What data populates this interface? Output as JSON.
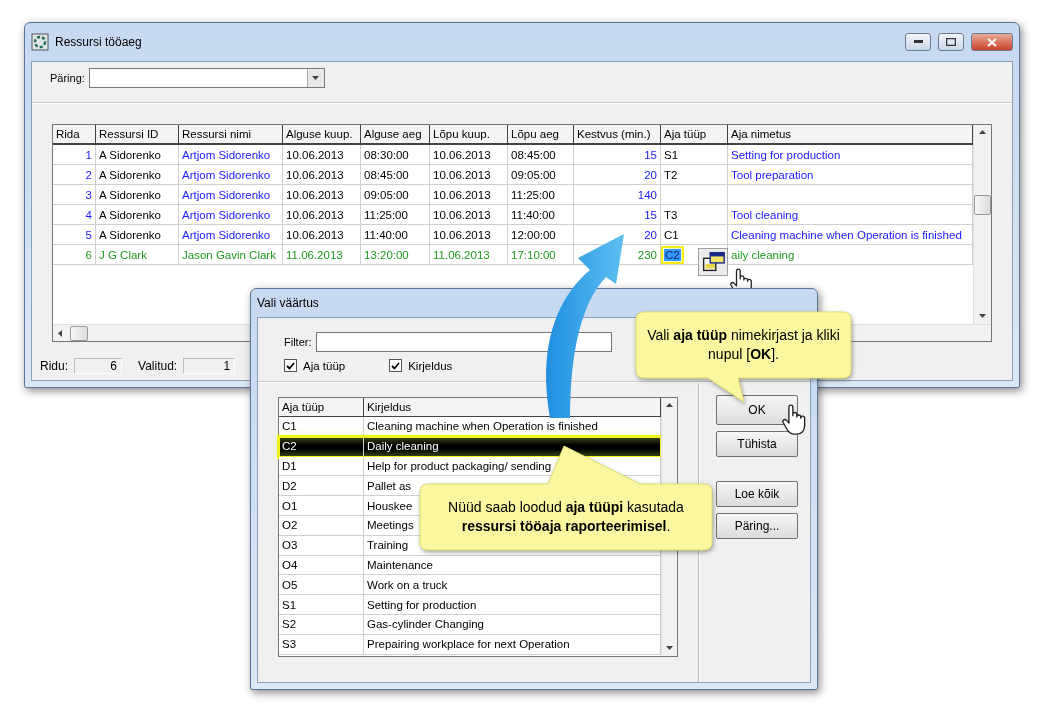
{
  "main_window": {
    "title": "Ressursi tööaeg",
    "query": {
      "label": "Päring:"
    },
    "table": {
      "columns": [
        {
          "label": "Rida",
          "kind": "number"
        },
        {
          "label": "Ressursi ID",
          "kind": "text"
        },
        {
          "label": "Ressursi nimi",
          "kind": "link"
        },
        {
          "label": "Alguse kuup.",
          "kind": "text"
        },
        {
          "label": "Alguse aeg",
          "kind": "text"
        },
        {
          "label": "Lõpu kuup.",
          "kind": "text"
        },
        {
          "label": "Lõpu aeg",
          "kind": "text"
        },
        {
          "label": "Kestvus (min.)",
          "kind": "number"
        },
        {
          "label": "Aja tüüp",
          "kind": "text"
        },
        {
          "label": "Aja nimetus",
          "kind": "link"
        }
      ],
      "rows": [
        {
          "color": "#1a1aff",
          "all_colored": false,
          "selected": false,
          "cells": [
            "1",
            "A Sidorenko",
            "Artjom Sidorenko",
            "10.06.2013",
            "08:30:00",
            "10.06.2013",
            "08:45:00",
            "15",
            "S1",
            "Setting for production"
          ]
        },
        {
          "color": "#1a1aff",
          "all_colored": false,
          "selected": false,
          "cells": [
            "2",
            "A Sidorenko",
            "Artjom Sidorenko",
            "10.06.2013",
            "08:45:00",
            "10.06.2013",
            "09:05:00",
            "20",
            "T2",
            "Tool preparation"
          ]
        },
        {
          "color": "#1a1aff",
          "all_colored": false,
          "selected": false,
          "cells": [
            "3",
            "A Sidorenko",
            "Artjom Sidorenko",
            "10.06.2013",
            "09:05:00",
            "10.06.2013",
            "11:25:00",
            "140",
            "",
            ""
          ]
        },
        {
          "color": "#1a1aff",
          "all_colored": false,
          "selected": false,
          "cells": [
            "4",
            "A Sidorenko",
            "Artjom Sidorenko",
            "10.06.2013",
            "11:25:00",
            "10.06.2013",
            "11:40:00",
            "15",
            "T3",
            "Tool cleaning"
          ]
        },
        {
          "color": "#1a1aff",
          "all_colored": false,
          "selected": false,
          "cells": [
            "5",
            "A Sidorenko",
            "Artjom Sidorenko",
            "10.06.2013",
            "11:40:00",
            "10.06.2013",
            "12:00:00",
            "20",
            "C1",
            "Cleaning machine when Operation is finished"
          ]
        },
        {
          "color": "#1f9a1f",
          "all_colored": true,
          "selected": true,
          "cells": [
            "6",
            "J G Clark",
            "Jason Gavin Clark",
            "11.06.2013",
            "13:20:00",
            "11.06.2013",
            "17:10:00",
            "230",
            "C2",
            "aily cleaning"
          ]
        }
      ]
    },
    "status_bar": [
      {
        "label": "Ridu:",
        "value": "6"
      },
      {
        "label": "Valitud:",
        "value": "1"
      }
    ]
  },
  "dialog": {
    "title": "Vali väärtus",
    "filter": {
      "label": "Filter:"
    },
    "checkboxes": [
      {
        "label": "Aja tüüp",
        "checked": true
      },
      {
        "label": "Kirjeldus",
        "checked": true
      }
    ],
    "list": {
      "columns": [
        "Aja tüüp",
        "Kirjeldus"
      ],
      "rows": [
        {
          "code": "C1",
          "description": "Cleaning machine when Operation is finished",
          "selected": false
        },
        {
          "code": "C2",
          "description": "Daily cleaning",
          "selected": true
        },
        {
          "code": "D1",
          "description": "Help for product packaging/ sending",
          "selected": false
        },
        {
          "code": "D2",
          "description": "Pallet as",
          "selected": false
        },
        {
          "code": "O1",
          "description": "Houskee",
          "selected": false
        },
        {
          "code": "O2",
          "description": "Meetings",
          "selected": false
        },
        {
          "code": "O3",
          "description": "Training",
          "selected": false
        },
        {
          "code": "O4",
          "description": "Maintenance",
          "selected": false
        },
        {
          "code": "O5",
          "description": "Work on a truck",
          "selected": false
        },
        {
          "code": "S1",
          "description": "Setting for production",
          "selected": false
        },
        {
          "code": "S2",
          "description": "Gas-cylinder Changing",
          "selected": false
        },
        {
          "code": "S3",
          "description": "Prepairing workplace for next Operation",
          "selected": false
        }
      ]
    },
    "button_groups": [
      [
        "OK",
        "Tühista"
      ],
      [
        "Loe kõik",
        "Päring..."
      ]
    ]
  },
  "callouts": [
    "Vali **aja tüüp** nimekirjast ja kliki nupul [**OK**].",
    "Nüüd saab loodud **aja tüüpi** kasutada **ressursi tööaja raporteerimisel**."
  ]
}
